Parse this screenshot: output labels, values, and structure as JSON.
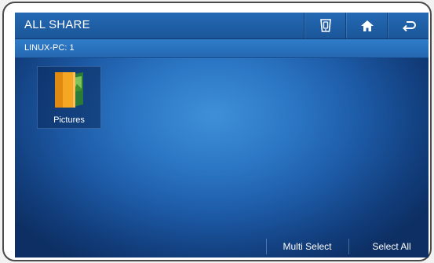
{
  "titlebar": {
    "title": "ALL SHARE",
    "buttons": [
      {
        "icon": "phone-share-icon"
      },
      {
        "icon": "home-icon"
      },
      {
        "icon": "back-icon"
      }
    ]
  },
  "subbar": {
    "device_label": "LINUX-PC: 1"
  },
  "items": [
    {
      "label": "Pictures",
      "icon": "pictures-folder-icon"
    }
  ],
  "bottombar": {
    "multi_select_label": "Multi Select",
    "select_all_label": "Select All"
  },
  "colors": {
    "accent": "#f5a623",
    "titlebar": "#1f5fa6",
    "background": "#1d5aa6"
  }
}
